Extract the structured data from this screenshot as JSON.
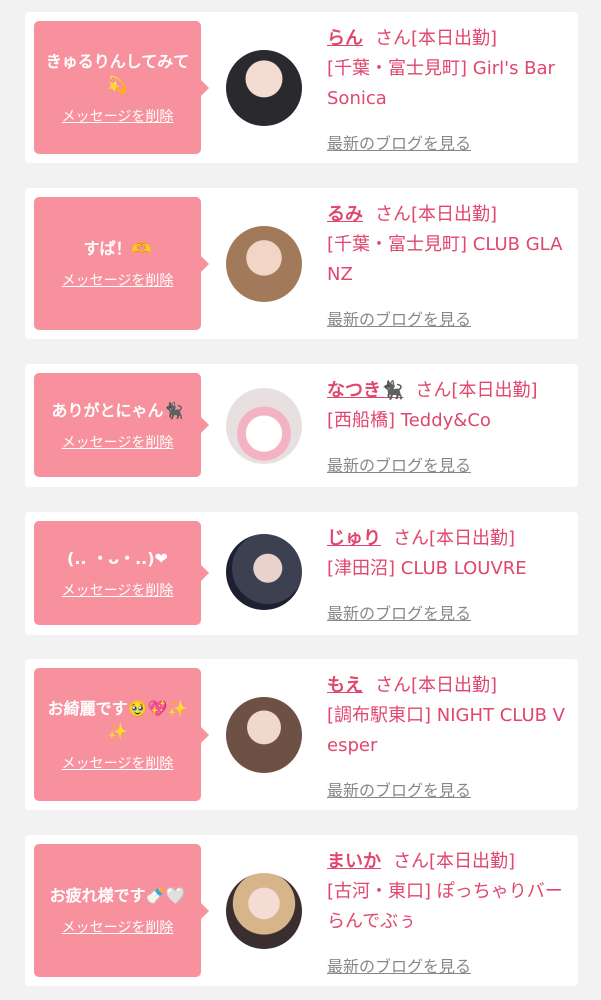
{
  "accent_color": "#f7919e",
  "name_color": "#e0466e",
  "delete_label": "メッセージを削除",
  "blog_label": "最新のブログを見る",
  "items": [
    {
      "message": "きゅるりんしてみて💫",
      "name": "らん",
      "honorific": "さん",
      "status": "[本日出勤]",
      "shop": "[千葉・富士見町] Girl's Bar Sonica",
      "avatar_tone": "dark-hair"
    },
    {
      "message": "すぱ！🫶",
      "name": "るみ",
      "honorific": "さん",
      "status": "[本日出勤]",
      "shop": "[千葉・富士見町] CLUB GLANZ",
      "avatar_tone": "light-brown-hair"
    },
    {
      "message": "ありがとにゃん🐈‍⬛",
      "name": "なつき🐈‍⬛",
      "honorific": "さん",
      "status": "[本日出勤]",
      "shop": "[西船橋] Teddy&Co",
      "avatar_tone": "pink-bow"
    },
    {
      "message": "(.. ・ᴗ・..)❤",
      "name": "じゅり",
      "honorific": "さん",
      "status": "[本日出勤]",
      "shop": "[津田沼] CLUB LOUVRE",
      "avatar_tone": "night-city"
    },
    {
      "message": "お綺麗です🥹💖✨✨",
      "name": "もえ",
      "honorific": "さん",
      "status": "[本日出勤]",
      "shop": "[調布駅東口] NIGHT CLUB Vesper",
      "avatar_tone": "brown-hair"
    },
    {
      "message": "お疲れ様です🍼🤍",
      "name": "まいか",
      "honorific": "さん",
      "status": "[本日出勤]",
      "shop": "[古河・東口] ぽっちゃりバー らんでぶぅ",
      "avatar_tone": "blonde-hair"
    }
  ]
}
